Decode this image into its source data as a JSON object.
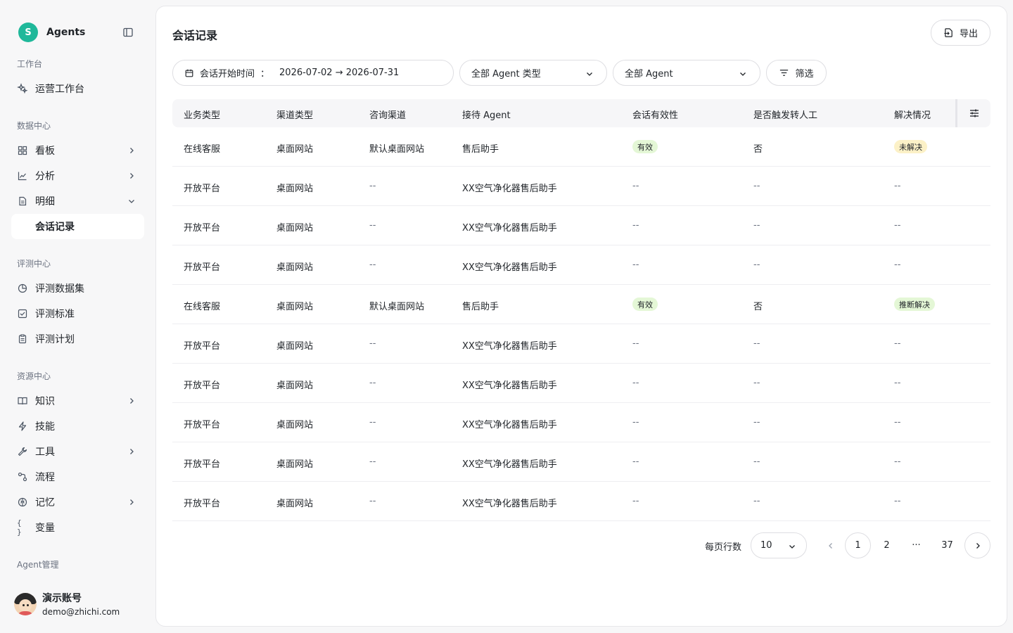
{
  "brand": {
    "logo_letter": "S",
    "name": "Agents"
  },
  "nav": {
    "workbench_section": "工作台",
    "ops_workbench": "运营工作台",
    "data_section": "数据中心",
    "dashboard": "看板",
    "analysis": "分析",
    "details": "明细",
    "session_records": "会话记录",
    "eval_section": "评测中心",
    "eval_dataset": "评测数据集",
    "eval_standard": "评测标准",
    "eval_plan": "评测计划",
    "resource_section": "资源中心",
    "knowledge": "知识",
    "skills": "技能",
    "tools": "工具",
    "flow": "流程",
    "memory": "记忆",
    "variables": "变量",
    "variables_icon_text": "{ }",
    "agent_section": "Agent管理"
  },
  "user": {
    "name": "演示账号",
    "email": "demo@zhichi.com"
  },
  "page": {
    "title": "会话记录",
    "export_label": "导出"
  },
  "filters": {
    "date_label": "会话开始时间",
    "date_colon": "：",
    "date_range": "2026-07-02 → 2026-07-31",
    "agent_type": "全部 Agent 类型",
    "agent": "全部 Agent",
    "filter_label": "筛选"
  },
  "table": {
    "columns": [
      "业务类型",
      "渠道类型",
      "咨询渠道",
      "接待 Agent",
      "会话有效性",
      "是否触发转人工",
      "解决情况"
    ],
    "rows": [
      [
        "在线客服",
        "桌面网站",
        "默认桌面网站",
        "售后助手",
        "有效",
        "否",
        "未解决"
      ],
      [
        "开放平台",
        "桌面网站",
        "--",
        "XX空气净化器售后助手",
        "--",
        "--",
        "--"
      ],
      [
        "开放平台",
        "桌面网站",
        "--",
        "XX空气净化器售后助手",
        "--",
        "--",
        "--"
      ],
      [
        "开放平台",
        "桌面网站",
        "--",
        "XX空气净化器售后助手",
        "--",
        "--",
        "--"
      ],
      [
        "在线客服",
        "桌面网站",
        "默认桌面网站",
        "售后助手",
        "有效",
        "否",
        "推断解决"
      ],
      [
        "开放平台",
        "桌面网站",
        "--",
        "XX空气净化器售后助手",
        "--",
        "--",
        "--"
      ],
      [
        "开放平台",
        "桌面网站",
        "--",
        "XX空气净化器售后助手",
        "--",
        "--",
        "--"
      ],
      [
        "开放平台",
        "桌面网站",
        "--",
        "XX空气净化器售后助手",
        "--",
        "--",
        "--"
      ],
      [
        "开放平台",
        "桌面网站",
        "--",
        "XX空气净化器售后助手",
        "--",
        "--",
        "--"
      ],
      [
        "开放平台",
        "桌面网站",
        "--",
        "XX空气净化器售后助手",
        "--",
        "--",
        "--"
      ]
    ]
  },
  "pagination": {
    "rows_per_page_label": "每页行数",
    "rows_per_page": "10",
    "pages": [
      "1",
      "2",
      "···",
      "37"
    ],
    "current": "1"
  },
  "colors": {
    "brand": "#1fb89a",
    "tag_valid": "#e4f7d6",
    "tag_unresolved": "#fcf1c7",
    "tag_inferred": "#e4f7d6"
  }
}
